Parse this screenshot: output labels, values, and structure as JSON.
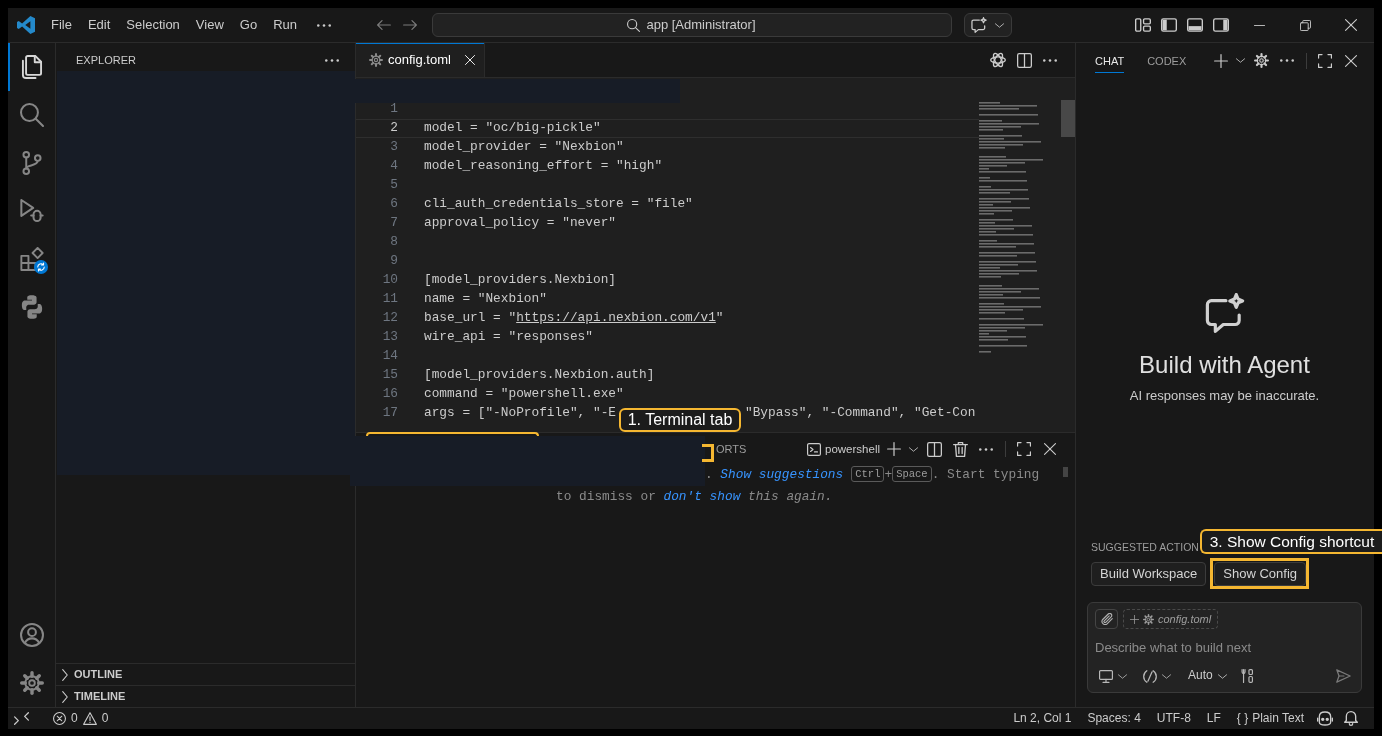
{
  "title_bar": {
    "menus": [
      {
        "label": "File"
      },
      {
        "label": "Edit"
      },
      {
        "label": "Selection"
      },
      {
        "label": "View"
      },
      {
        "label": "Go"
      },
      {
        "label": "Run"
      }
    ],
    "command_center": "app [Administrator]"
  },
  "activity_bar": {
    "items": [
      {
        "kind": "files",
        "selected": true,
        "badge": false
      },
      {
        "kind": "search",
        "selected": false,
        "badge": false
      },
      {
        "kind": "source_control",
        "selected": false,
        "badge": false
      },
      {
        "kind": "run_debug",
        "selected": false,
        "badge": false
      },
      {
        "kind": "extensions",
        "selected": false,
        "badge": true
      },
      {
        "kind": "python",
        "selected": false,
        "badge": false
      }
    ],
    "bottom_items": [
      {
        "kind": "account"
      },
      {
        "kind": "settings"
      }
    ]
  },
  "sidebar": {
    "title": "EXPLORER",
    "sections": [
      {
        "label": "OUTLINE",
        "expanded": false
      },
      {
        "label": "TIMELINE",
        "expanded": false
      }
    ]
  },
  "editor": {
    "tabs": [
      {
        "label": "config.toml",
        "selected": true
      }
    ],
    "lines": [
      {
        "number": "1",
        "current": false
      },
      {
        "number": "2",
        "current": true,
        "segments": [
          {
            "kind": "plain",
            "text": "model = \"oc/big-pickle\""
          }
        ]
      },
      {
        "number": "3",
        "current": false,
        "segments": [
          {
            "kind": "plain",
            "text": "model_provider = \"Nexbion\""
          }
        ]
      },
      {
        "number": "4",
        "current": false,
        "segments": [
          {
            "kind": "plain",
            "text": "model_reasoning_effort = \"high\""
          }
        ]
      },
      {
        "number": "5",
        "current": false
      },
      {
        "number": "6",
        "current": false,
        "segments": [
          {
            "kind": "plain",
            "text": "cli_auth_credentials_store = \"file\""
          }
        ]
      },
      {
        "number": "7",
        "current": false,
        "segments": [
          {
            "kind": "plain",
            "text": "approval_policy = \"never\""
          }
        ]
      },
      {
        "number": "8",
        "current": false
      },
      {
        "number": "9",
        "current": false
      },
      {
        "number": "10",
        "current": false,
        "segments": [
          {
            "kind": "plain",
            "text": "[model_providers.Nexbion]"
          }
        ]
      },
      {
        "number": "11",
        "current": false,
        "segments": [
          {
            "kind": "plain",
            "text": "name = \"Nexbion\""
          }
        ]
      },
      {
        "number": "12",
        "current": false,
        "segments": [
          {
            "kind": "plain",
            "text": "base_url = \""
          },
          {
            "kind": "link",
            "text": "https://api.nexbion.com/v1"
          },
          {
            "kind": "plain",
            "text": "\""
          }
        ]
      },
      {
        "number": "13",
        "current": false,
        "segments": [
          {
            "kind": "plain",
            "text": "wire_api = \"responses\""
          }
        ]
      },
      {
        "number": "14",
        "current": false
      },
      {
        "number": "15",
        "current": false,
        "segments": [
          {
            "kind": "plain",
            "text": "[model_providers.Nexbion.auth]"
          }
        ]
      },
      {
        "number": "16",
        "current": false,
        "segments": [
          {
            "kind": "plain",
            "text": "command = \"powershell.exe\""
          }
        ]
      },
      {
        "number": "17",
        "current": false,
        "segments": [
          {
            "kind": "plain",
            "text": "args = [\"-NoProfile\", \"-E"
          },
          {
            "kind": "after_overlay",
            "text": "\"Bypass\", \"-Command\", \"Get-Con"
          }
        ]
      }
    ]
  },
  "panel": {
    "tabs": [
      {
        "label": "ORTS",
        "selected": false
      }
    ],
    "terminal": "powershell",
    "hint_lines": [
      {
        "segments": [
          {
            "kind": "plain",
            "text": ". "
          },
          {
            "kind": "link",
            "text": "Show suggestions"
          },
          {
            "kind": "key",
            "text": "Ctrl"
          },
          {
            "kind": "plain",
            "text": "+"
          },
          {
            "kind": "key",
            "text": "Space"
          },
          {
            "kind": "plain",
            "text": ". Start typing"
          }
        ]
      },
      {
        "segments": [
          {
            "kind": "plain",
            "text": "to dismiss or "
          },
          {
            "kind": "link",
            "text": "don't show"
          },
          {
            "kind": "italic",
            "text": " this again."
          }
        ]
      }
    ]
  },
  "chat": {
    "tabs": [
      {
        "label": "CHAT",
        "selected": true
      },
      {
        "label": "CODEX",
        "selected": false
      }
    ],
    "heading": "Build with Agent",
    "disclaimer": "AI responses may be inaccurate.",
    "suggestions_label": "SUGGESTED ACTION",
    "suggestions": [
      {
        "label": "Build Workspace",
        "highlighted": false
      },
      {
        "label": "Show Config",
        "highlighted": true
      }
    ],
    "context_file": "config.toml",
    "composer": {
      "placeholder": "Describe what to build next",
      "mode": "Auto"
    }
  },
  "annotations": [
    {
      "label": "1. Terminal tab"
    },
    {
      "label": "3. Show Config shortcut"
    }
  ],
  "status_bar": {
    "problems": [
      {
        "kind": "error",
        "count": "0"
      },
      {
        "kind": "warning",
        "count": "0"
      }
    ],
    "items": [
      {
        "text": "Ln 2, Col 1"
      },
      {
        "text": "Spaces: 4"
      },
      {
        "text": "UTF-8"
      },
      {
        "text": "LF"
      },
      {
        "prefix": "{ }",
        "text": "Plain Text"
      }
    ]
  }
}
